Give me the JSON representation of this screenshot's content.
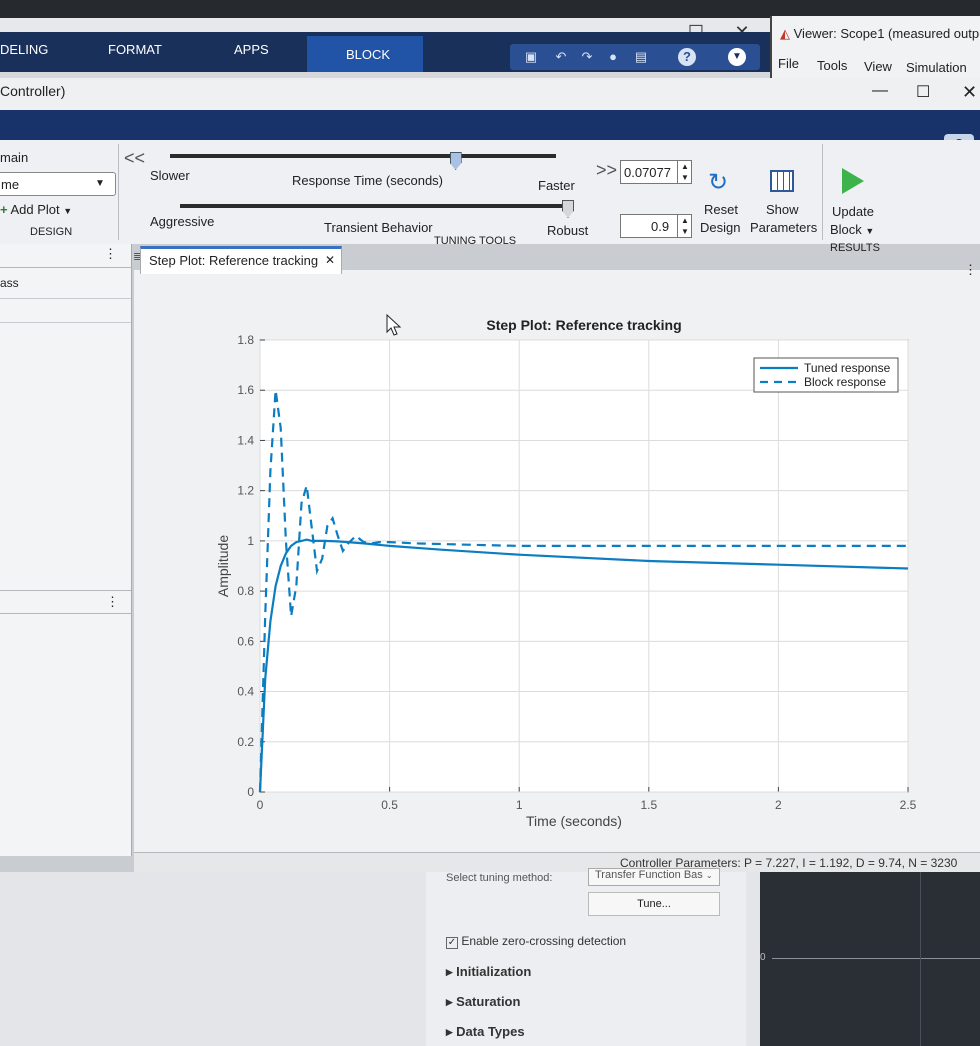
{
  "simulink": {
    "tabs": [
      "DELING",
      "FORMAT",
      "APPS",
      "BLOCK"
    ],
    "window_buttons": [
      "—",
      "☐",
      "✕"
    ],
    "controller_label": "Controller)"
  },
  "viewer": {
    "title": "Viewer: Scope1 (measured outpu",
    "menu": [
      "File",
      "Tools",
      "View",
      "Simulation"
    ]
  },
  "pid": {
    "window_buttons": [
      "—",
      "☐",
      "✕"
    ],
    "help": "?",
    "left": {
      "domain_label": "main",
      "dropdown_value": "me",
      "add_plot": "Add Plot",
      "section": "DESIGN",
      "pane_item": "ass"
    },
    "tuning": {
      "collapse": "<<",
      "expand": ">>",
      "slower": "Slower",
      "response_time": "Response Time (seconds)",
      "faster": "Faster",
      "response_time_value": "0.07077",
      "response_time_frac": 0.74,
      "aggressive": "Aggressive",
      "transient": "Transient Behavior",
      "robust": "Robust",
      "transient_value": "0.9",
      "transient_frac": 1.0,
      "section": "TUNING TOOLS"
    },
    "buttons": {
      "reset_1": "Reset",
      "reset_2": "Design",
      "show_1": "Show",
      "show_2": "Parameters",
      "update_1": "Update",
      "update_2": "Block",
      "section": "RESULTS"
    },
    "doc_tab": "Step Plot: Reference tracking",
    "doc_tab_close": "✕",
    "status": "Controller Parameters: P = 7.227, I = 1.192, D = 9.74, N = 3230"
  },
  "chart_data": {
    "type": "line",
    "title": "Step Plot: Reference tracking",
    "xlabel": "Time (seconds)",
    "ylabel": "Amplitude",
    "xlim": [
      0,
      2.5
    ],
    "ylim": [
      0,
      1.8
    ],
    "xticks": [
      "0",
      "0.5",
      "1",
      "1.5",
      "2",
      "2.5"
    ],
    "yticks": [
      "0",
      "0.2",
      "0.4",
      "0.6",
      "0.8",
      "1",
      "1.2",
      "1.4",
      "1.6",
      "1.8"
    ],
    "grid": true,
    "legend_position": "top-right",
    "series": [
      {
        "name": "Tuned response",
        "style": "solid",
        "color": "#0b7dc1",
        "x": [
          0,
          0.02,
          0.04,
          0.06,
          0.08,
          0.1,
          0.12,
          0.14,
          0.16,
          0.18,
          0.2,
          0.25,
          0.3,
          0.4,
          0.5,
          0.7,
          1.0,
          1.5,
          2.0,
          2.5
        ],
        "y": [
          0,
          0.45,
          0.68,
          0.82,
          0.9,
          0.95,
          0.98,
          0.995,
          1.0,
          1.005,
          1.0,
          1.0,
          0.998,
          0.99,
          0.98,
          0.965,
          0.945,
          0.92,
          0.905,
          0.89
        ]
      },
      {
        "name": "Block response",
        "style": "dashed",
        "color": "#0b7dc1",
        "x": [
          0,
          0.02,
          0.04,
          0.06,
          0.08,
          0.1,
          0.12,
          0.14,
          0.16,
          0.18,
          0.2,
          0.22,
          0.24,
          0.26,
          0.28,
          0.3,
          0.32,
          0.34,
          0.37,
          0.4,
          0.43,
          0.46,
          0.5,
          0.6,
          0.8,
          1.0,
          1.5,
          2.0,
          2.5
        ],
        "y": [
          0,
          0.7,
          1.28,
          1.6,
          1.45,
          1.0,
          0.7,
          0.82,
          1.15,
          1.22,
          1.05,
          0.88,
          0.93,
          1.06,
          1.09,
          1.02,
          0.96,
          0.99,
          1.02,
          0.995,
          0.99,
          0.995,
          0.995,
          0.99,
          0.985,
          0.98,
          0.98,
          0.98,
          0.98
        ]
      }
    ]
  },
  "background_dialog": {
    "select_label": "Select tuning method:",
    "select_value": "Transfer Function Bas",
    "tune_button": "Tune...",
    "zero_crossing": "Enable zero-crossing detection",
    "sections": [
      "Initialization",
      "Saturation",
      "Data Types"
    ],
    "scope_tick": "0"
  },
  "colors": {
    "ribbon_dark": "#19305a",
    "tab_active": "#2153a6",
    "line": "#0b7dc1",
    "green_play": "#3cb44b"
  },
  "icons": [
    "save-icon",
    "undo-icon",
    "redo-icon",
    "help-icon",
    "reset-design-icon",
    "show-parameters-icon",
    "update-block-icon"
  ]
}
